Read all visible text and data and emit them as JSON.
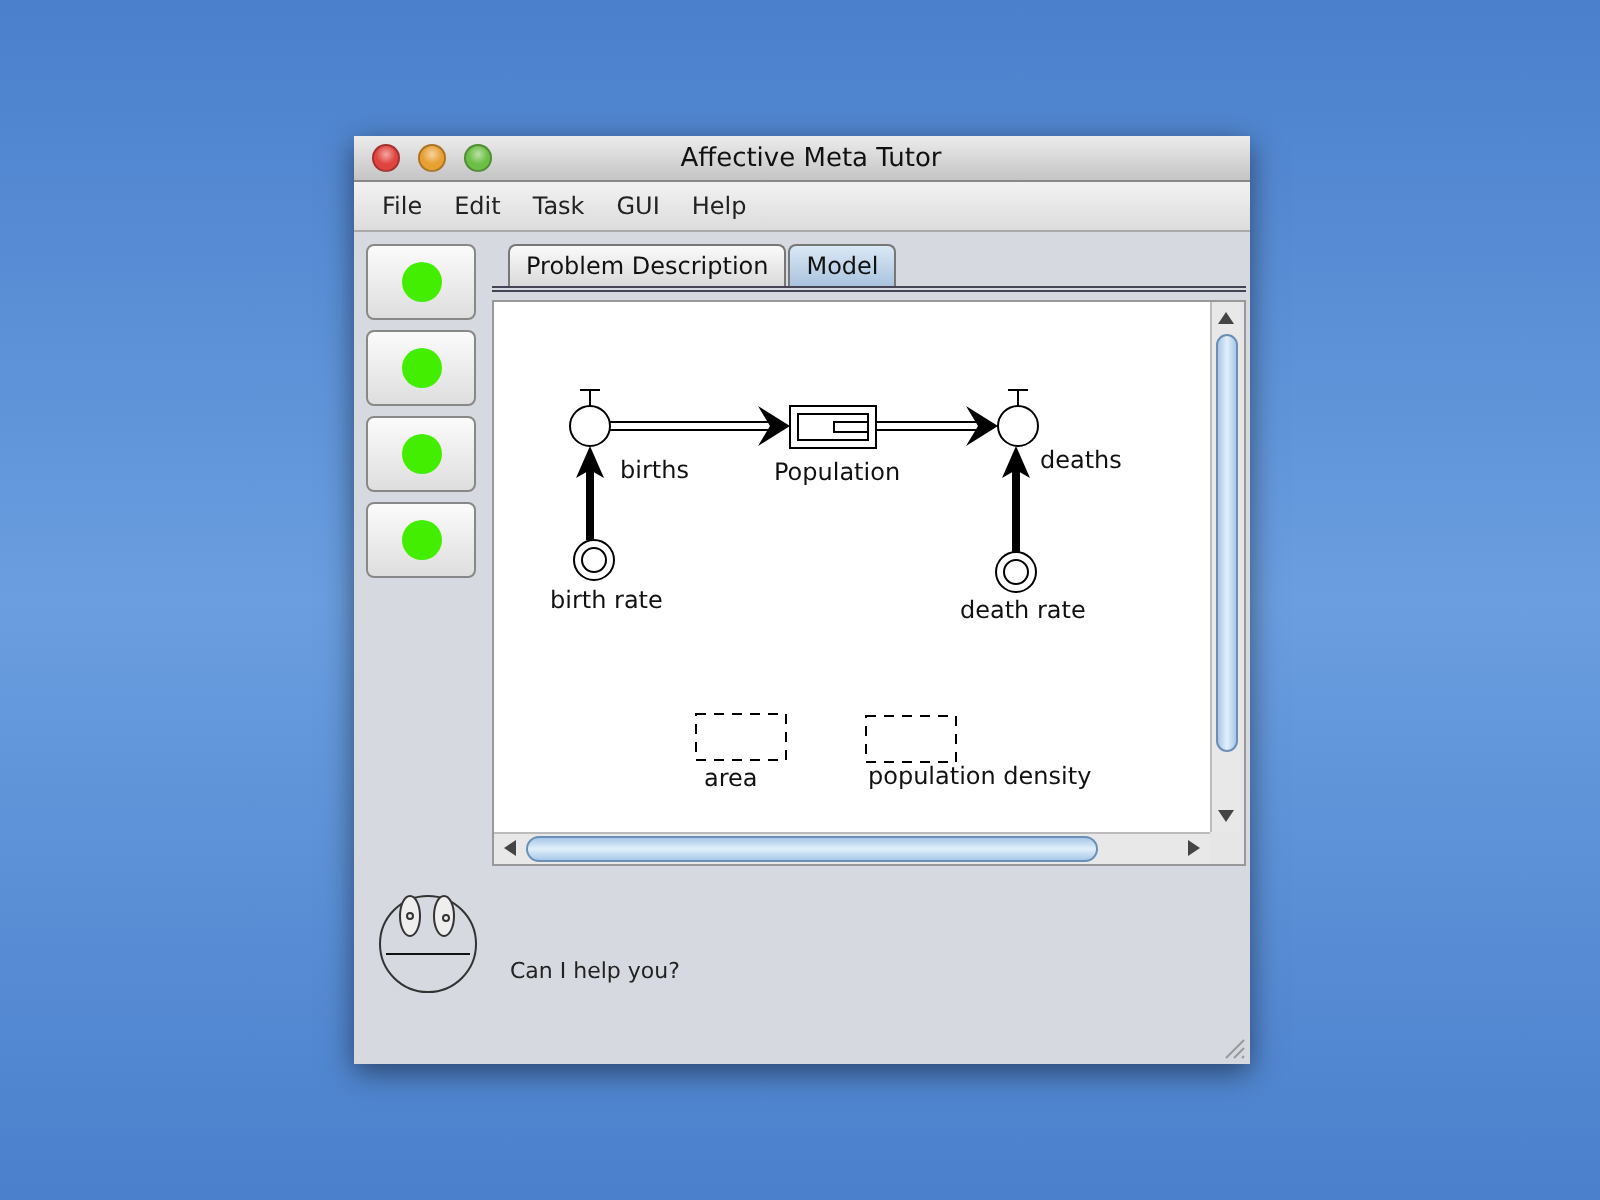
{
  "window": {
    "title": "Affective Meta Tutor"
  },
  "menu": [
    "File",
    "Edit",
    "Task",
    "GUI",
    "Help"
  ],
  "status_lights": [
    {
      "color": "#44ee00"
    },
    {
      "color": "#44ee00"
    },
    {
      "color": "#44ee00"
    },
    {
      "color": "#44ee00"
    }
  ],
  "tabs": [
    {
      "label": "Problem Description",
      "selected": false
    },
    {
      "label": "Model",
      "selected": true
    }
  ],
  "diagram": {
    "nodes": [
      {
        "kind": "flow",
        "label": "births"
      },
      {
        "kind": "stock",
        "label": "Population"
      },
      {
        "kind": "flow",
        "label": "deaths"
      },
      {
        "kind": "constant",
        "label": "birth rate"
      },
      {
        "kind": "constant",
        "label": "death rate"
      },
      {
        "kind": "auxiliary",
        "label": "area"
      },
      {
        "kind": "auxiliary",
        "label": "population density"
      }
    ]
  },
  "tutor": {
    "message": "Can I help you?"
  }
}
